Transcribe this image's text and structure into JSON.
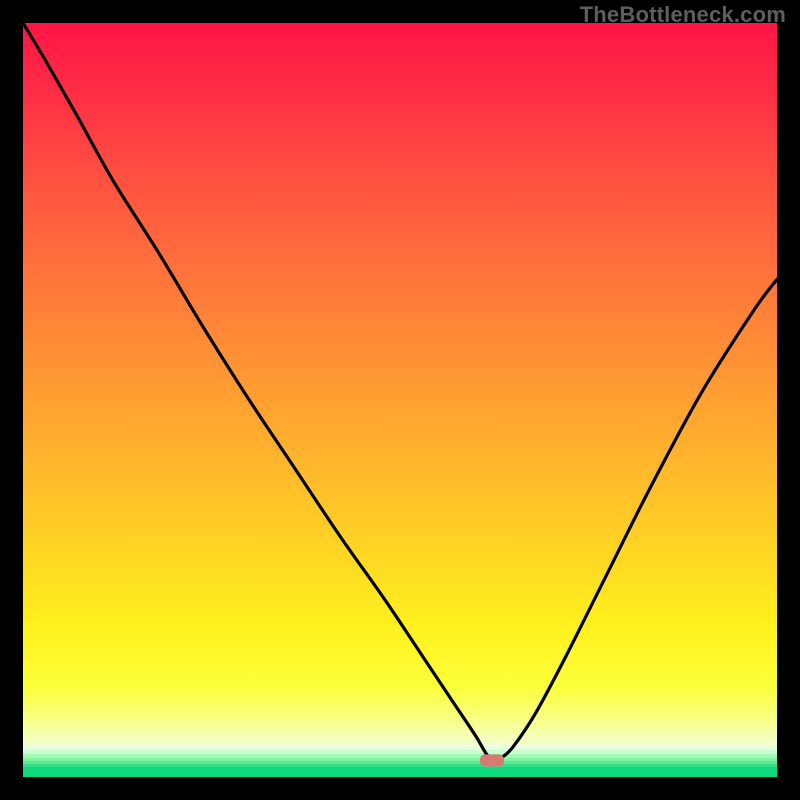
{
  "watermark_text": "TheBottleneck.com",
  "colors": {
    "frame_bg": "#000000",
    "watermark": "#5e5e5e",
    "curve_stroke": "#000000",
    "marker_fill": "#d87a74"
  },
  "chart_data": {
    "type": "line",
    "title": "",
    "xlabel": "",
    "ylabel": "",
    "xlim": [
      0,
      100
    ],
    "ylim": [
      0,
      100
    ],
    "grid": false,
    "legend": false,
    "series": [
      {
        "name": "bottleneck-curve",
        "x": [
          0,
          3,
          7,
          12,
          18,
          24,
          30,
          36,
          42,
          48,
          53,
          57,
          60,
          61.5,
          62.5,
          63.5,
          65,
          68,
          72,
          77,
          83,
          90,
          97,
          100
        ],
        "y": [
          100,
          95,
          88,
          79,
          69.5,
          59.5,
          50,
          41,
          32,
          23.5,
          16,
          10,
          5.5,
          3,
          2.2,
          2.6,
          4,
          8.5,
          16,
          26,
          38,
          51,
          62,
          66
        ]
      }
    ],
    "minimum_marker": {
      "x": 62.2,
      "y": 2.2,
      "w": 3.2,
      "h": 1.6
    },
    "note": "Values are approximate, read from pixel positions within the 754x754 plot area. x and y are percentages of plot width/height (y increases upward)."
  },
  "bottom_bands": [
    {
      "h": 5,
      "color": "#e6ffe0"
    },
    {
      "h": 4,
      "color": "#c7ffce"
    },
    {
      "h": 4,
      "color": "#a4f9b7"
    },
    {
      "h": 3,
      "color": "#7ef1a3"
    },
    {
      "h": 3,
      "color": "#5ae895"
    },
    {
      "h": 3,
      "color": "#33de87"
    },
    {
      "h": 10,
      "color": "#0fd97d"
    }
  ]
}
